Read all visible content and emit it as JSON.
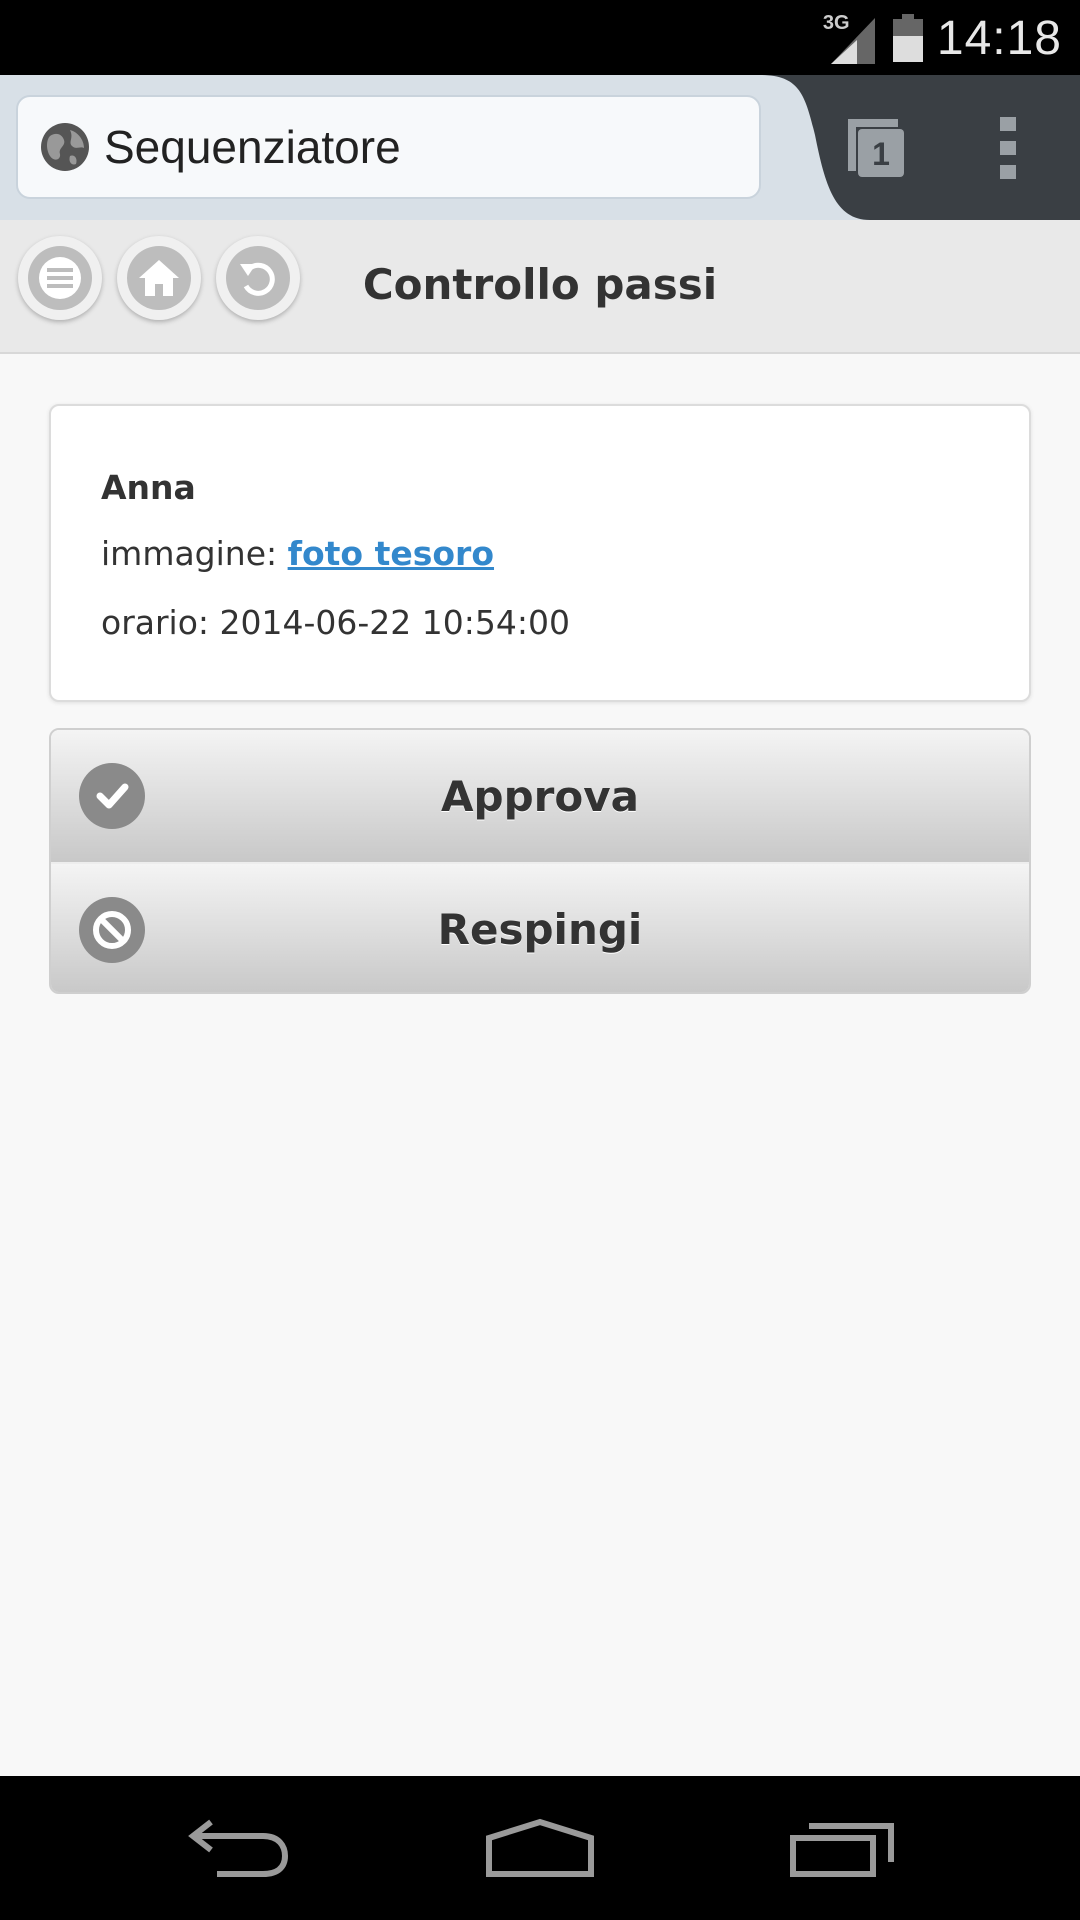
{
  "status_bar": {
    "network": "3G",
    "time": "14:18"
  },
  "browser": {
    "url_title": "Sequenziatore",
    "tab_count": "1",
    "icons": {
      "globe": "globe-icon",
      "tabs": "tabs-icon",
      "menu": "overflow-menu-icon"
    }
  },
  "header": {
    "title": "Controllo passi",
    "buttons": [
      "menu-icon",
      "home-icon",
      "back-icon"
    ]
  },
  "record": {
    "name": "Anna",
    "image_label": "immagine: ",
    "image_link": "foto tesoro",
    "time_label": "orario: ",
    "time_value": "2014-06-22 10:54:00"
  },
  "actions": {
    "approve": "Approva",
    "reject": "Respingi"
  },
  "colors": {
    "link": "#3388cc",
    "header_bg": "#e9e9e9",
    "content_bg": "#f8f8f8"
  }
}
